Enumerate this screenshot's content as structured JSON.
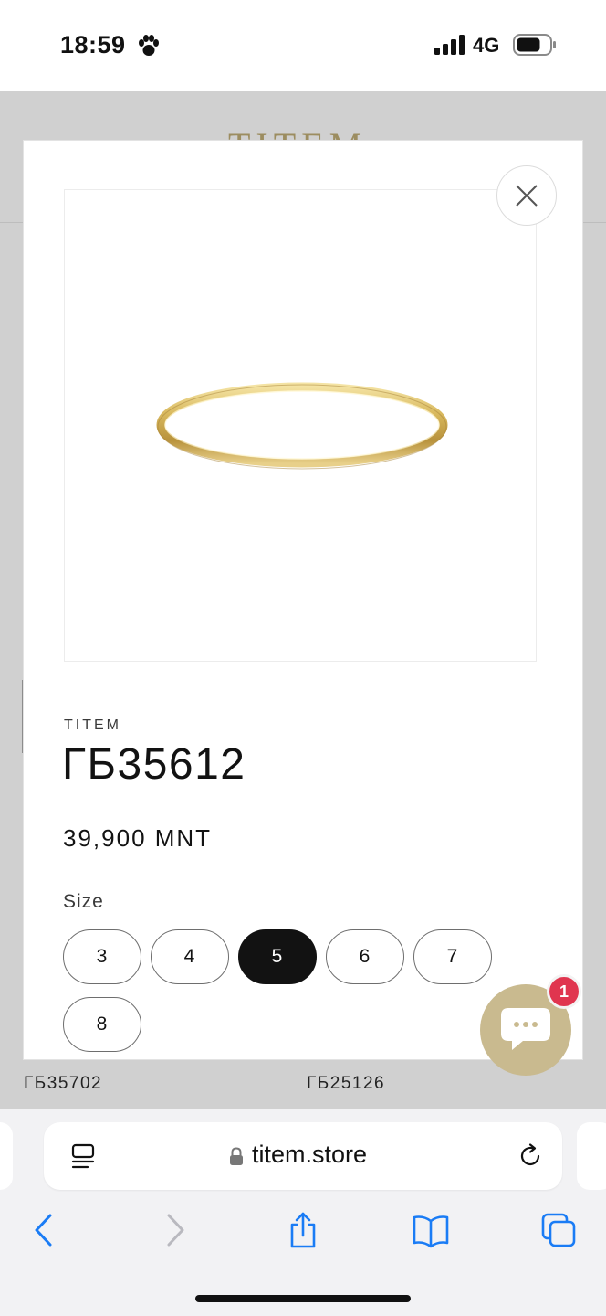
{
  "status_bar": {
    "time": "18:59",
    "network": "4G"
  },
  "background_page": {
    "logo": "TITEM",
    "products": [
      "ГБ35702",
      "ГБ25126"
    ]
  },
  "modal": {
    "vendor": "TITEM",
    "title": "ГБ35612",
    "price": "39,900 MNT",
    "size_label": "Size",
    "sizes": [
      "3",
      "4",
      "5",
      "6",
      "7",
      "8"
    ],
    "selected_size": "5",
    "image_alt_icon": "gold-ring-image",
    "close_icon": "close-icon"
  },
  "chat": {
    "badge_count": "1",
    "icon": "chat-bubble-icon",
    "color": "#c9ba8f",
    "badge_color": "#e0354f"
  },
  "browser": {
    "url": "titem.store",
    "toolbar_icons": [
      "back-icon",
      "forward-icon",
      "share-icon",
      "bookmarks-icon",
      "tabs-icon"
    ],
    "accent": "#1a7cf5"
  }
}
